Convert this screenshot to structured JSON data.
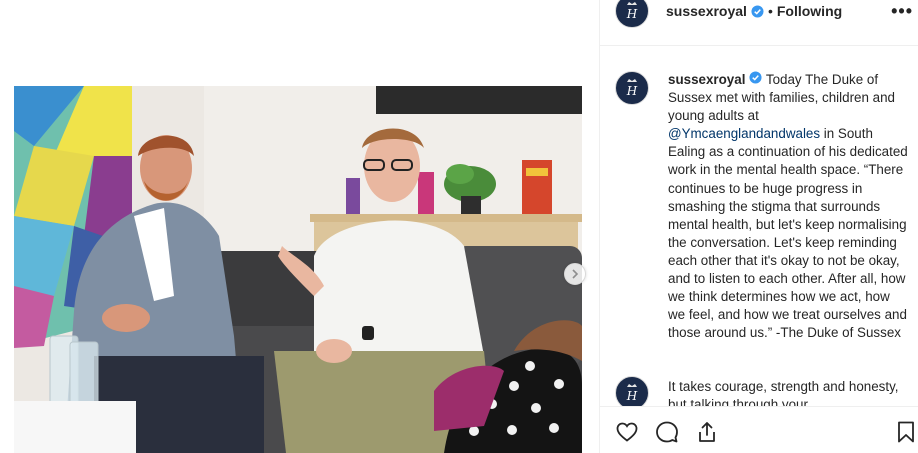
{
  "post": {
    "username": "sussexroyal",
    "follow_state": "Following",
    "separator": "•",
    "more_label": "•••"
  },
  "caption": {
    "username": "sussexroyal",
    "text_part1": " Today The Duke of Sussex met with families, children and young adults at ",
    "mention": "@Ymcaenglandandwales",
    "text_part2": " in South Ealing as a continuation of his dedicated work in the mental health space. “There continues to be huge progress in smashing the stigma that surrounds mental health, but let's keep normalising the conversation. Let's keep reminding each other that it's okay to not be okay, and to listen to each other. After all, how we think determines how we act, how we feel, and how we treat ourselves and those around us.” -The Duke of Sussex"
  },
  "comment": {
    "text": "It takes courage, strength and honesty, but talking through your"
  },
  "icons": {
    "avatar": "royal-monogram-icon",
    "verified": "verified-badge-icon",
    "like": "heart-icon",
    "comment": "speech-bubble-icon",
    "share": "share-icon",
    "save": "bookmark-icon",
    "carousel": "chevron-right-icon"
  },
  "colors": {
    "verified": "#3897f0",
    "mention": "#003569",
    "avatar_bg": "#1b2b4a",
    "text": "#262626",
    "divider": "#efefef"
  }
}
